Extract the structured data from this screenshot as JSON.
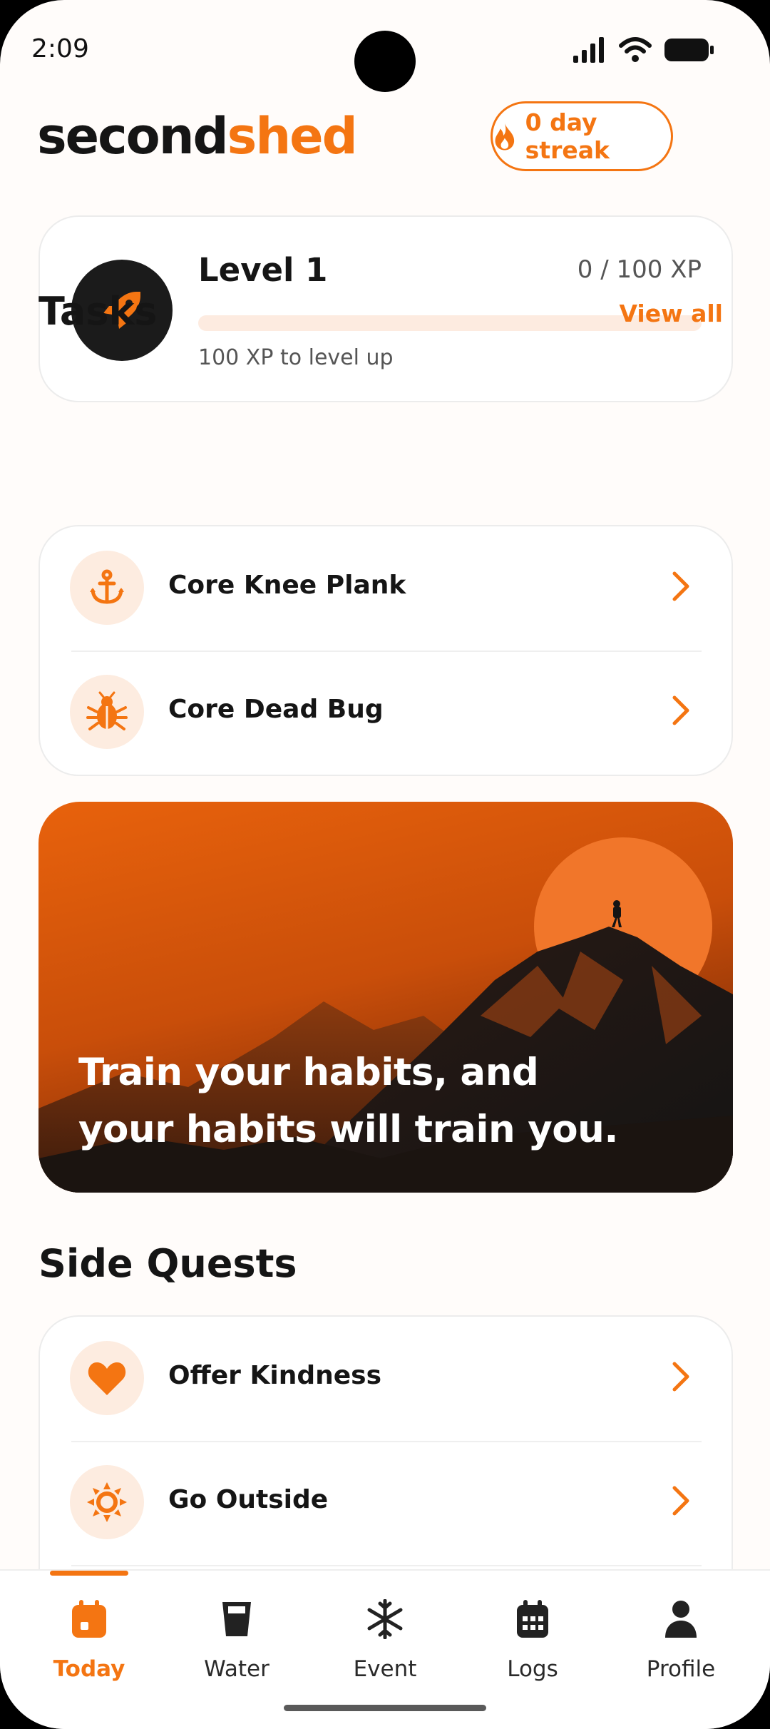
{
  "status_bar": {
    "time": "2:09",
    "icons": [
      "cellular-signal-icon",
      "wifi-icon",
      "battery-icon"
    ]
  },
  "header": {
    "brand_part1": "second",
    "brand_part2": "shed",
    "streak_label": "0 day streak",
    "streak_icon": "flame-icon"
  },
  "level": {
    "title": "Level 1",
    "xp_text": "0 / 100 XP",
    "progress_fraction": 0,
    "subtitle": "100 XP to level up",
    "icon": "rocket-icon"
  },
  "tasks": {
    "title": "Tasks",
    "view_all": "View all",
    "items": [
      {
        "label": "Core Knee Plank",
        "icon": "anchor-icon"
      },
      {
        "label": "Core Dead Bug",
        "icon": "bug-icon"
      }
    ]
  },
  "banner": {
    "line1": "Train your habits, and",
    "line2": "your habits will train you."
  },
  "side_quests": {
    "title": "Side Quests",
    "items": [
      {
        "label": "Offer Kindness",
        "icon": "heart-icon"
      },
      {
        "label": "Go Outside",
        "icon": "sun-icon"
      }
    ]
  },
  "nav": {
    "items": [
      {
        "label": "Today",
        "icon": "calendar-day-icon",
        "active": true
      },
      {
        "label": "Water",
        "icon": "water-glass-icon",
        "active": false
      },
      {
        "label": "Event",
        "icon": "snowflake-icon",
        "active": false
      },
      {
        "label": "Logs",
        "icon": "calendar-grid-icon",
        "active": false
      },
      {
        "label": "Profile",
        "icon": "person-icon",
        "active": false
      }
    ]
  },
  "colors": {
    "accent": "#f47512",
    "accent_light": "#fdece0",
    "text": "#151515",
    "background": "#fffcfa"
  }
}
